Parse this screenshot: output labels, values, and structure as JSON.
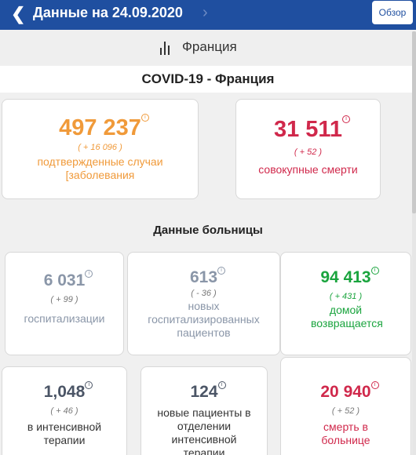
{
  "header": {
    "title": "Данные на 24.09.2020",
    "back_icon": "chevron-left-icon",
    "forward_icon": "chevron-right-icon",
    "overview_label": "Обзор"
  },
  "country": {
    "icon": "bar-chart-icon",
    "name": "Франция"
  },
  "covid_title": "COVID-19 - Франция",
  "summary": {
    "cases": {
      "value": "497 237",
      "delta": "( + 16 096 )",
      "label": "подтвержденные случаи [заболевания"
    },
    "deaths": {
      "value": "31 511",
      "delta": "( + 52 )",
      "label": "совокупные смерти"
    }
  },
  "hospital_title": "Данные больницы",
  "hospital": {
    "hospitalizations": {
      "value": "6 031",
      "delta": "( + 99 )",
      "label": "госпитализации"
    },
    "new_hospitalized": {
      "value": "613",
      "delta": "( - 36 )",
      "label": "новых госпитализированных пациентов"
    },
    "returned_home": {
      "value": "94 413",
      "delta": "( + 431 )",
      "label": "домой возвращается"
    },
    "icu": {
      "value": "1,048",
      "delta": "( + 46 )",
      "label": "в интенсивной терапии"
    },
    "new_icu": {
      "value": "124",
      "label": "новые пациенты в отделении интенсивной терапии"
    },
    "hospital_deaths": {
      "value": "20 940",
      "delta": "( + 52 )",
      "label": "смерть в больнице"
    }
  },
  "info_glyph": "i",
  "colors": {
    "header_bg": "#1f4fa0",
    "cases": "#f09a3a",
    "deaths": "#d0284b",
    "hospital_muted": "#8a96a8",
    "returned_home": "#1aa43e",
    "icu": "#4b5566"
  }
}
